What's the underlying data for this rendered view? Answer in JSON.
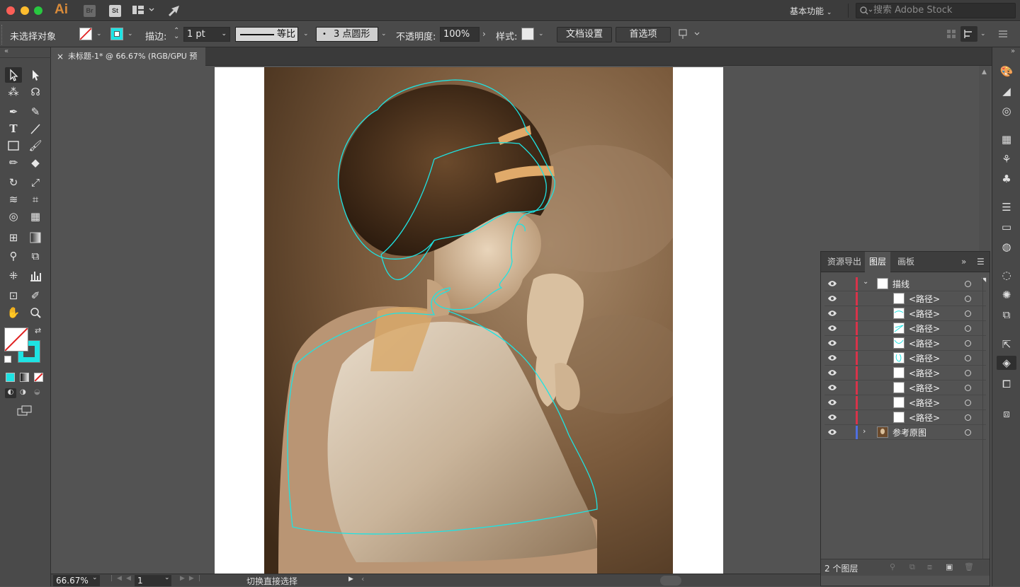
{
  "app": {
    "logo": "Ai",
    "bridge_label": "Br",
    "stock_label": "St",
    "workspace": "基本功能",
    "stock_search_placeholder": "搜索 Adobe Stock"
  },
  "control_bar": {
    "selection_status": "未选择对象",
    "stroke_label": "描边:",
    "stroke_weight": "1 pt",
    "profile_label": "等比",
    "brush_label": "3 点圆形",
    "opacity_label": "不透明度:",
    "opacity_value": "100%",
    "style_label": "样式:",
    "doc_setup_button": "文档设置",
    "preferences_button": "首选项"
  },
  "document": {
    "tab_title": "未标题-1* @ 66.67% (RGB/GPU 预览)",
    "zoom": "66.67%",
    "artboard_number": "1",
    "status_text": "切换直接选择"
  },
  "layers_panel": {
    "tabs": [
      "资源导出",
      "图层",
      "画板"
    ],
    "active_tab": "图层",
    "layers": [
      {
        "name": "描线",
        "color": "#d8334a",
        "expanded": true
      },
      {
        "name": "参考原图",
        "color": "#4f6fe0",
        "expanded": false
      }
    ],
    "sublayers": [
      "<路径>",
      "<路径>",
      "<路径>",
      "<路径>",
      "<路径>",
      "<路径>",
      "<路径>",
      "<路径>",
      "<路径>"
    ],
    "footer_count": "2 个图层"
  },
  "colors": {
    "accent_cyan": "#1ee3e3",
    "layer_red": "#d8334a",
    "layer_blue": "#4f6fe0"
  }
}
